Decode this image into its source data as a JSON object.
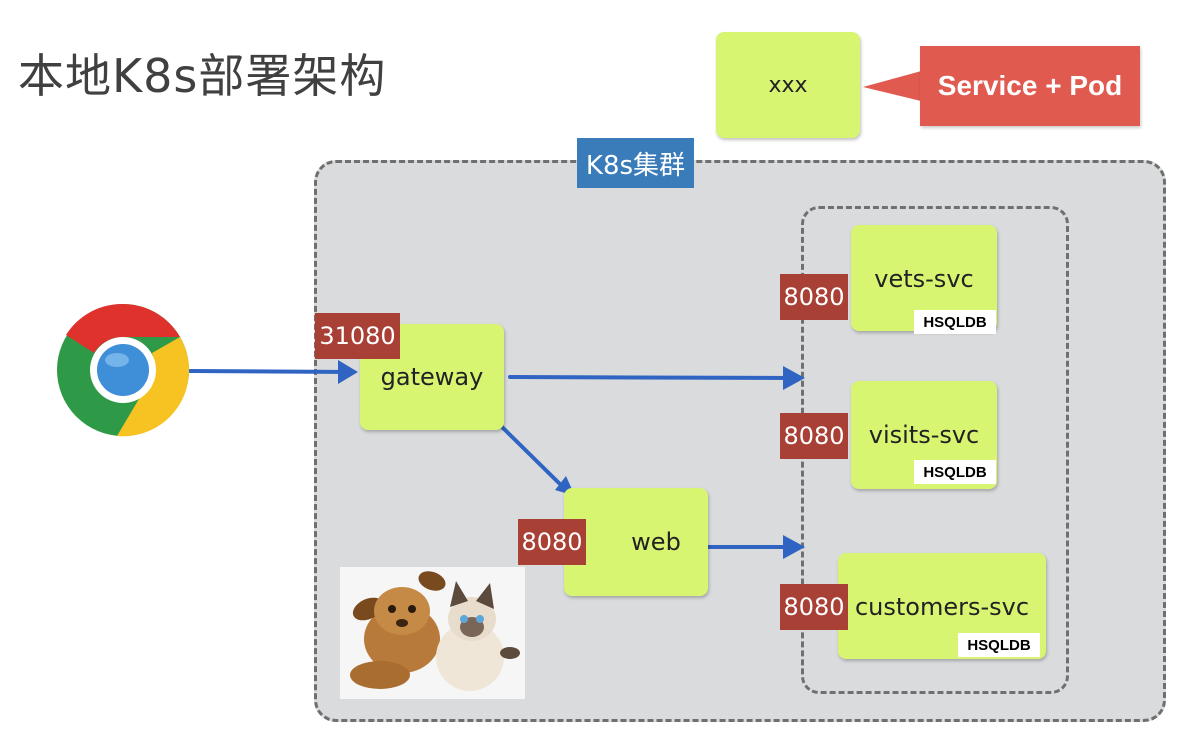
{
  "title": "本地K8s部署架构",
  "legend": {
    "sample_label": "xxx",
    "callout_text": "Service + Pod"
  },
  "cluster": {
    "label": "K8s集群"
  },
  "nodes": {
    "gateway": {
      "label": "gateway",
      "port": "31080"
    },
    "web": {
      "label": "web",
      "port": "8080"
    },
    "vets": {
      "label": "vets-svc",
      "port": "8080",
      "db": "HSQLDB"
    },
    "visits": {
      "label": "visits-svc",
      "port": "8080",
      "db": "HSQLDB"
    },
    "customers": {
      "label": "customers-svc",
      "port": "8080",
      "db": "HSQLDB"
    }
  },
  "colors": {
    "node_fill": "#d8f572",
    "port_fill": "#a94036",
    "cluster_label_fill": "#3a7cba",
    "callout_fill": "#e05a4f",
    "arrow": "#2f64c2",
    "cluster_fill": "#dadbdd"
  },
  "icons": {
    "browser": "chrome-browser-icon",
    "pets_image": "puppy-and-kitten-photo"
  }
}
